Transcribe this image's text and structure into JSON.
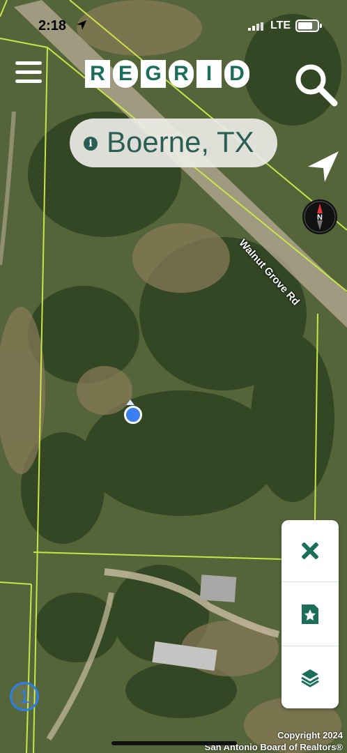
{
  "status_bar": {
    "time": "2:18",
    "network": "LTE"
  },
  "brand": {
    "letters": [
      "R",
      "E",
      "G",
      "R",
      "I",
      "D"
    ],
    "color": "#1a6e5a"
  },
  "location": {
    "name": "Boerne, TX",
    "info_symbol": "i"
  },
  "map": {
    "road_label": "Walnut Grove Rd",
    "compass_label": "N",
    "parcel_line_color": "#c8e64a"
  },
  "toolbar": {
    "items": [
      "edit-tools-icon",
      "bookmark-star-icon",
      "layers-icon"
    ]
  },
  "badge": {
    "count": "1"
  },
  "footer": {
    "copyright_line1": "Copyright 2024",
    "copyright_line2": "San Antonio Board of Realtors®"
  }
}
